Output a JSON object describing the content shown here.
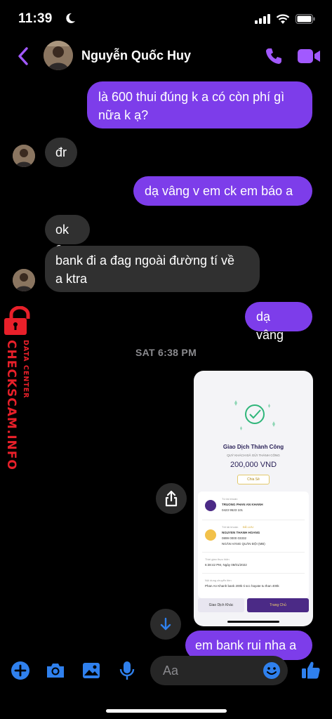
{
  "status_bar": {
    "time": "11:39"
  },
  "header": {
    "contact_name": "Nguyễn Quốc Huy"
  },
  "messages": [
    {
      "sender": "me",
      "text_line1": "là 600 thui đúng k a có còn phí gì",
      "text_line2": "nữa k ạ?"
    },
    {
      "sender": "them",
      "text": "đr"
    },
    {
      "sender": "me",
      "text": "dạ vâng v em ck em báo a"
    },
    {
      "sender": "them",
      "text": "ok e"
    },
    {
      "sender": "them",
      "text_line1": "bank đi a đag ngoài đường tí về",
      "text_line2": "a ktra"
    },
    {
      "sender": "me",
      "text": "dạ vâng"
    },
    {
      "sender": "me",
      "text": "em bank rui nha a"
    }
  ],
  "timestamp": "SAT 6:38 PM",
  "receipt": {
    "title": "Giao Dịch Thành Công",
    "subtitle": "QUÝ KHÁCH ĐÃ GỬI THÀNH CÔNG",
    "amount": "200,000 VND",
    "share_label": "Chia Sẻ",
    "from_label": "Từ tài khoản",
    "from_name": "TRUONG PHAN AN KHANH",
    "from_account": "0423 9523 101",
    "to_label": "Tới tài khoản",
    "to_saved": "ĐÃ LƯU",
    "to_name": "NGUYEN THANH HOANG",
    "to_account": "0899 0000 03332",
    "to_bank": "NGÂN HÀNG QUÂN ĐỘI (MB)",
    "time_label": "Thời gian thực hiện",
    "time_value": "6:38:42 PM, Ngày 08/01/2022",
    "content_label": "Nội dung chuyển tiền",
    "content_value": "Phan An Khanh bank 200k ti scc hayate tu than 400k",
    "btn_other": "Giao Dịch Khác",
    "btn_home": "Trang Chủ"
  },
  "watermark": {
    "main": "CHECKSCAM.INFO",
    "sub": "DATA CENTER"
  },
  "composer": {
    "placeholder": "Aa"
  },
  "colors": {
    "accent": "#a259ff",
    "bubble_me": "#7d3dea",
    "bubble_them": "#303030",
    "composer_icon": "#2f80ed",
    "watermark": "#e8202a"
  }
}
